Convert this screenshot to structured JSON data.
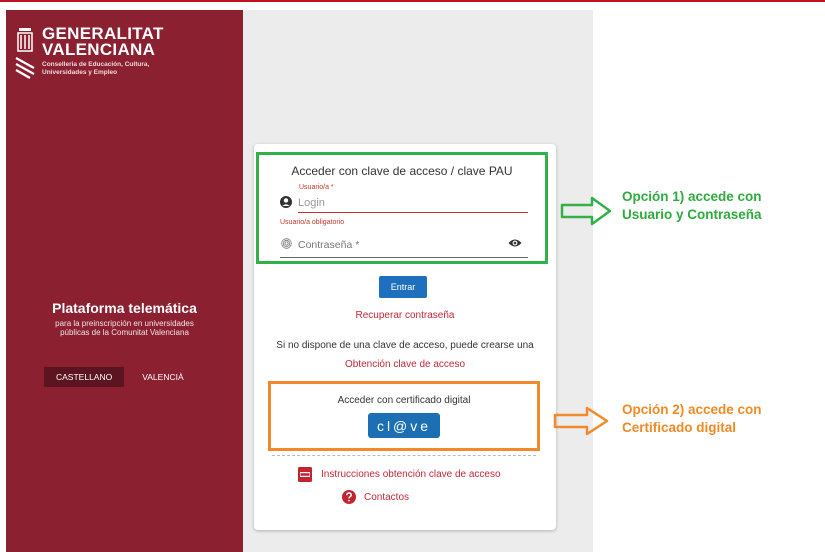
{
  "branding": {
    "line1": "GENERALITAT",
    "line2": "VALENCIANA",
    "sub1": "Conselleria de Educación, Cultura,",
    "sub2": "Universidades y Empleo"
  },
  "platform": {
    "title": "Plataforma telemática",
    "desc1": "para la preinscripción en universidades",
    "desc2": "públicas de la Comunitat Valenciana"
  },
  "languages": [
    "CASTELLANO",
    "VALENCIÀ"
  ],
  "login": {
    "title": "Acceder con clave de acceso / clave PAU",
    "user_label": "Usuario/a *",
    "user_placeholder": "Login",
    "user_error": "Usuario/a obligatorio",
    "pass_placeholder": "Contraseña *",
    "submit": "Entrar",
    "recover": "Recuperar contraseña",
    "no_key_text": "Si no dispone de una clave de acceso, puede crearse una",
    "obtain_key": "Obtención clave de acceso"
  },
  "certificate": {
    "title": "Acceder con certificado digital",
    "button": "cl@ve"
  },
  "footer_links": {
    "instructions": "Instrucciones obtención clave de acceso",
    "contacts": "Contactos"
  },
  "annotations": {
    "option1_line1": "Opción 1) accede con",
    "option1_line2": "Usuario y Contraseña",
    "option2_line1": "Opción 2) accede con",
    "option2_line2": "Certificado digital"
  },
  "colors": {
    "sidebar": "#8a2030",
    "accent_green": "#33b046",
    "accent_orange": "#f08a2a",
    "button_blue": "#1f6fbf",
    "link_red": "#c0283a"
  }
}
